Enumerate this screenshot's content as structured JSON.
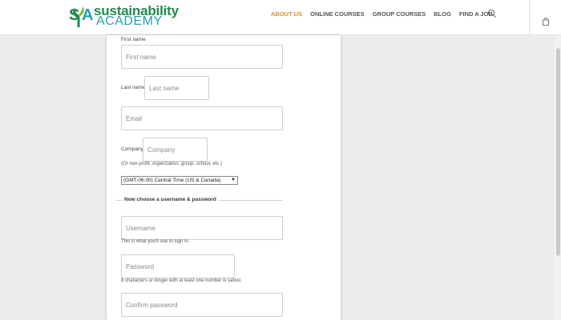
{
  "brand": {
    "name_top": "sustainability",
    "name_bottom": "ACADEMY",
    "mark": "SA",
    "colors": {
      "green": "#1f8a4c",
      "teal": "#22a0b8",
      "accent": "#e58a2b"
    }
  },
  "nav": {
    "items": [
      {
        "label": "ABOUT US",
        "active": true
      },
      {
        "label": "ONLINE COURSES",
        "active": false
      },
      {
        "label": "GROUP COURSES",
        "active": false
      },
      {
        "label": "BLOG",
        "active": false
      },
      {
        "label": "FIND A JOB",
        "active": false
      }
    ],
    "search_icon": "search-icon",
    "bag_icon": "shopping-bag-icon"
  },
  "form": {
    "first_name": {
      "label": "First name",
      "placeholder": "First name"
    },
    "last_name": {
      "label": "Last name",
      "placeholder": "Last name"
    },
    "email": {
      "placeholder": "Email"
    },
    "company": {
      "label": "Company",
      "placeholder": "Company",
      "hint": "(Or non-profit, organization, group, school, etc.)"
    },
    "timezone": {
      "value": "(GMT-06:00) Central Time (US & Canada)"
    },
    "section_title": "Now choose a username & password",
    "username": {
      "placeholder": "Username",
      "hint": "This is what you'll use to sign in."
    },
    "password": {
      "placeholder": "Password",
      "hint": "8 characters or longer with at least one number is safest."
    },
    "confirm_password": {
      "placeholder": "Confirm password"
    }
  }
}
